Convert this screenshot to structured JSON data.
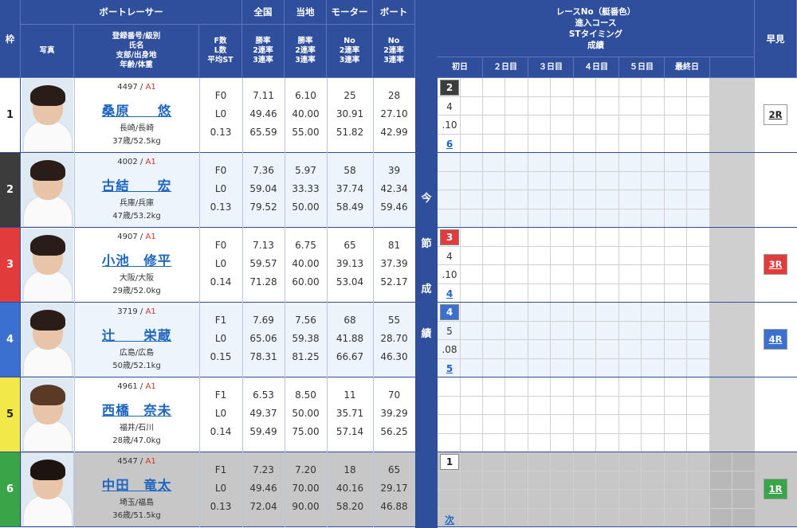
{
  "header": {
    "waku": "枠",
    "photo": "写真",
    "boatracer": "ボートレーサー",
    "info_lines": [
      "登録番号/級別",
      "氏名",
      "支部/出身地",
      "年齢/体重"
    ],
    "fl_lines": [
      "F数",
      "L数",
      "平均ST"
    ],
    "zenkoku": "全国",
    "touchi": "当地",
    "motor": "モーター",
    "boat": "ボート",
    "rate_lines": [
      "勝率",
      "2連率",
      "3連率"
    ],
    "no_lines": [
      "No",
      "2連率",
      "3連率"
    ],
    "race_lines": [
      "レースNo（艇番色）",
      "進入コース",
      "STタイミング",
      "成績"
    ],
    "days": [
      "初日",
      "２日目",
      "３日目",
      "４日目",
      "５日目",
      "最終日"
    ],
    "hayami": "早見"
  },
  "konsetsu": [
    "今",
    "節",
    "成",
    "績"
  ],
  "racers": [
    {
      "waku": "1",
      "reg": "4497",
      "cls": "A1",
      "name": "桑原　　悠",
      "branch": "長崎/長崎",
      "age": "37歳/52.5kg",
      "f": "F0",
      "l": "L0",
      "st": "0.13",
      "z": [
        "7.11",
        "49.46",
        "65.59"
      ],
      "t": [
        "6.10",
        "40.00",
        "55.00"
      ],
      "m": [
        "25",
        "30.91",
        "51.82"
      ],
      "b": [
        "28",
        "27.10",
        "42.99"
      ],
      "race": "2",
      "course": "4",
      "timing": ".10",
      "result": "6",
      "hayami": "2R"
    },
    {
      "waku": "2",
      "reg": "4002",
      "cls": "A1",
      "name": "古結　　宏",
      "branch": "兵庫/兵庫",
      "age": "47歳/53.2kg",
      "f": "F0",
      "l": "L0",
      "st": "0.13",
      "z": [
        "7.36",
        "59.04",
        "79.52"
      ],
      "t": [
        "5.97",
        "33.33",
        "50.00"
      ],
      "m": [
        "58",
        "37.74",
        "58.49"
      ],
      "b": [
        "39",
        "42.34",
        "59.46"
      ],
      "race": "",
      "course": "",
      "timing": "",
      "result": "",
      "hayami": ""
    },
    {
      "waku": "3",
      "reg": "4907",
      "cls": "A1",
      "name": "小池　修平",
      "branch": "大阪/大阪",
      "age": "29歳/52.0kg",
      "f": "F0",
      "l": "L0",
      "st": "0.14",
      "z": [
        "7.13",
        "59.57",
        "71.28"
      ],
      "t": [
        "6.75",
        "40.00",
        "60.00"
      ],
      "m": [
        "65",
        "39.13",
        "53.04"
      ],
      "b": [
        "81",
        "37.39",
        "52.17"
      ],
      "race": "3",
      "course": "4",
      "timing": ".10",
      "result": "4",
      "hayami": "3R"
    },
    {
      "waku": "4",
      "reg": "3719",
      "cls": "A1",
      "name": "辻　　栄蔵",
      "branch": "広島/広島",
      "age": "50歳/52.1kg",
      "f": "F1",
      "l": "L0",
      "st": "0.15",
      "z": [
        "7.69",
        "65.06",
        "78.31"
      ],
      "t": [
        "7.56",
        "59.38",
        "81.25"
      ],
      "m": [
        "68",
        "41.88",
        "66.67"
      ],
      "b": [
        "55",
        "28.70",
        "46.30"
      ],
      "race": "4",
      "course": "5",
      "timing": ".08",
      "result": "5",
      "hayami": "4R"
    },
    {
      "waku": "5",
      "reg": "4961",
      "cls": "A1",
      "name": "西橋　奈未",
      "branch": "福井/石川",
      "age": "28歳/47.0kg",
      "f": "F1",
      "l": "L0",
      "st": "0.14",
      "z": [
        "6.53",
        "49.37",
        "59.49"
      ],
      "t": [
        "8.50",
        "50.00",
        "75.00"
      ],
      "m": [
        "11",
        "35.71",
        "57.14"
      ],
      "b": [
        "70",
        "39.29",
        "56.25"
      ],
      "race": "",
      "course": "",
      "timing": "",
      "result": "",
      "hayami": ""
    },
    {
      "waku": "6",
      "reg": "4547",
      "cls": "A1",
      "name": "中田　竜太",
      "branch": "埼玉/福島",
      "age": "36歳/51.5kg",
      "f": "F1",
      "l": "L0",
      "st": "0.13",
      "z": [
        "7.23",
        "49.46",
        "72.04"
      ],
      "t": [
        "7.20",
        "70.00",
        "90.00"
      ],
      "m": [
        "18",
        "40.16",
        "58.20"
      ],
      "b": [
        "65",
        "29.17",
        "46.88"
      ],
      "race": "1",
      "course": "",
      "timing": "",
      "result": "次",
      "hayami": "1R"
    }
  ],
  "colors": {
    "header": "#2f4e9c",
    "waku": [
      "#ffffff",
      "#3c3c3c",
      "#e13b3b",
      "#3b6fd0",
      "#f2e84a",
      "#3aa449"
    ],
    "waku_text": [
      "#222222",
      "#ffffff",
      "#ffffff",
      "#ffffff",
      "#222222",
      "#ffffff"
    ]
  }
}
